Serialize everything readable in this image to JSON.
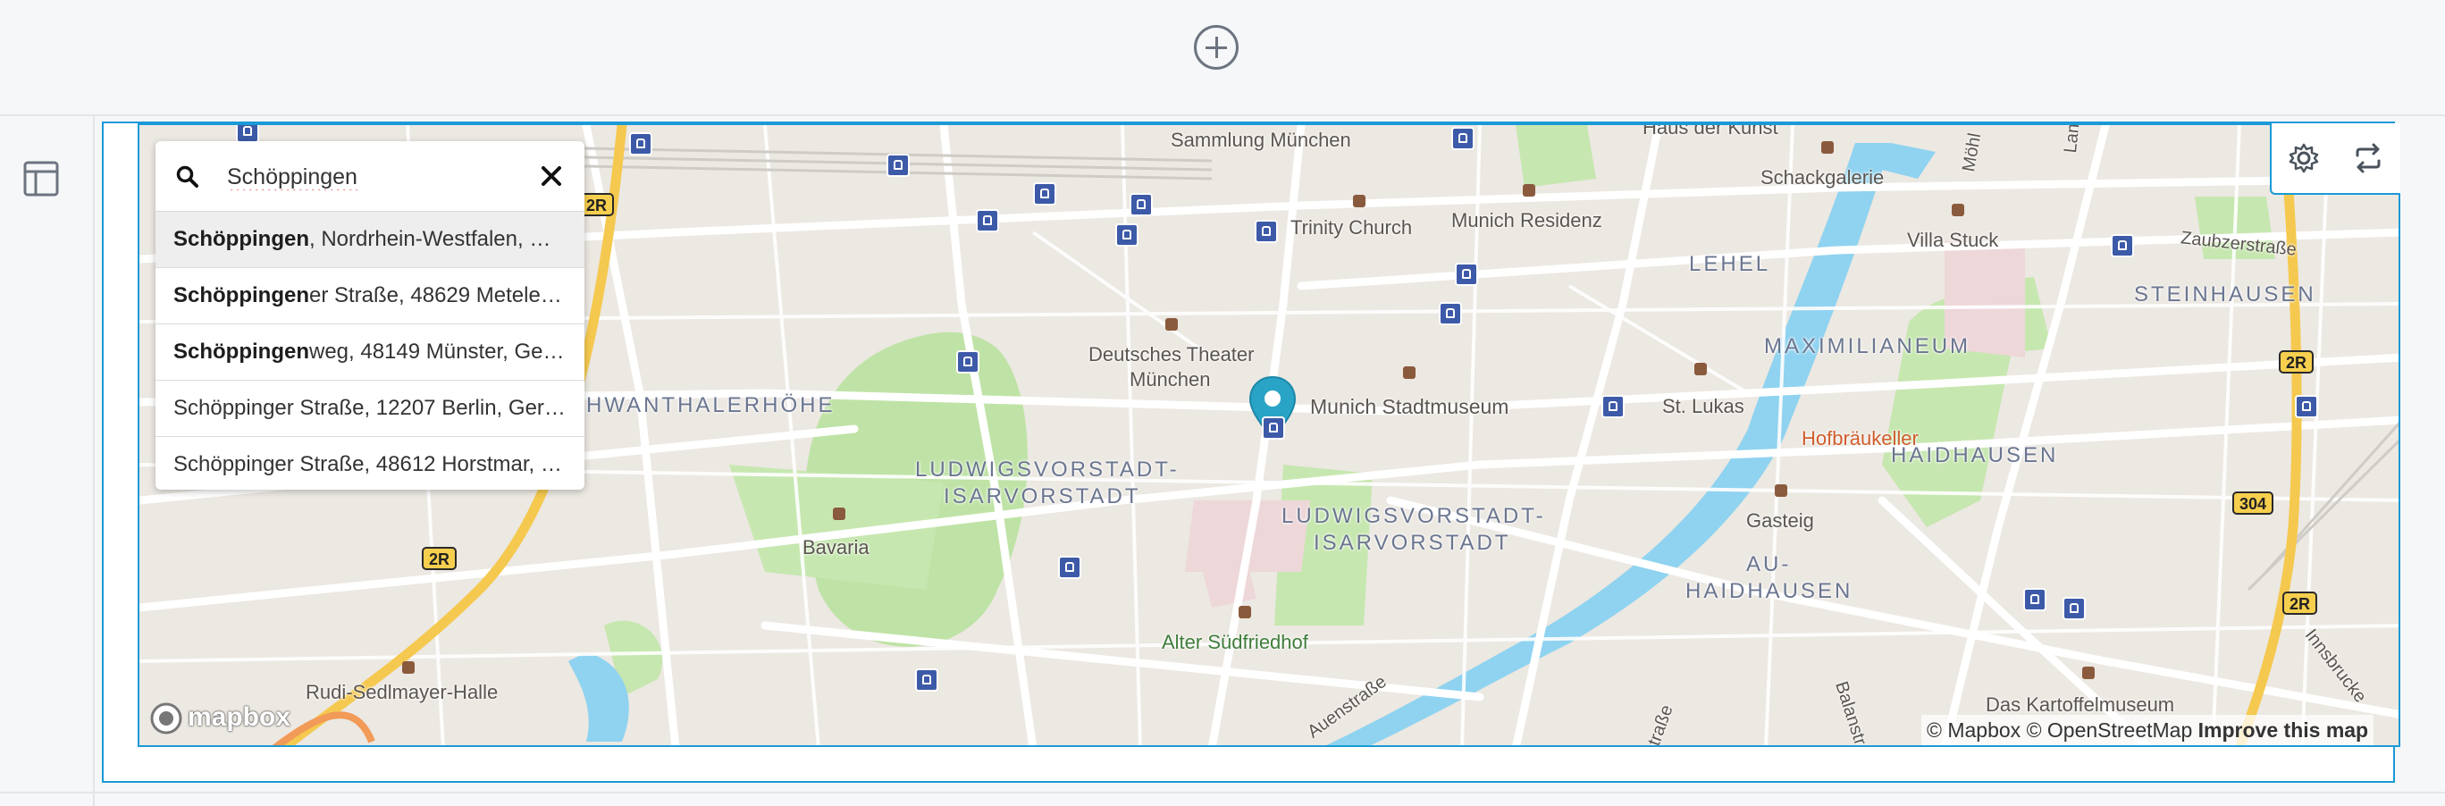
{
  "toolbar": {
    "add_icon": "plus-circle-icon"
  },
  "sidebar": {
    "layout_icon": "layout-icon"
  },
  "map_controls": {
    "settings_icon": "gear-icon",
    "swap_icon": "repeat-icon"
  },
  "search": {
    "value": "Schöppingen",
    "suggestions": [
      {
        "match": "Schöppingen",
        "rest": ", Nordrhein-Westfalen, G…"
      },
      {
        "match": "Schöppingen",
        "rest": "er Straße, 48629 Metele…"
      },
      {
        "match": "Schöppingen",
        "rest": "weg, 48149 Münster, Ge…"
      },
      {
        "match": "",
        "rest": "Schöppinger Straße, 12207 Berlin, Ger…"
      },
      {
        "match": "",
        "rest": "Schöppinger Straße, 48612 Horstmar, …"
      }
    ]
  },
  "map_labels": {
    "sammlung": "Sammlung München",
    "haus_kunst": "Haus der Kunst",
    "trinity": "Trinity Church",
    "residenz": "Munich Residenz",
    "schackgalerie": "Schackgalerie",
    "villa_stuck": "Villa Stuck",
    "zaubzer": "Zaubzerstraße",
    "lamont": "Lamontstr.",
    "moehl": "Möhl",
    "lehel": "LEHEL",
    "steinhausen": "STEINHAUSEN",
    "maximilianeum": "MAXIMILIANEUM",
    "theater": "Deutsches Theater",
    "theater2": "München",
    "schwanthaler": "HWANTHALERHÖHE",
    "stadtmuseum": "Munich Stadtmuseum",
    "st_lukas": "St. Lukas",
    "hofbraeu": "Hofbräukeller",
    "haidhausen": "HAIDHAUSEN",
    "ludwig1a": "LUDWIGSVORSTADT-",
    "ludwig1b": "ISARVORSTADT",
    "ludwig2a": "LUDWIGSVORSTADT-",
    "ludwig2b": "ISARVORSTADT",
    "bavaria": "Bavaria",
    "gasteig": "Gasteig",
    "au1": "AU-",
    "au2": "HAIDHAUSEN",
    "alter": "Alter Südfriedhof",
    "rudi": "Rudi-Sedlmayer-Halle",
    "auen": "Auenstraße",
    "balan": "Balanstr.",
    "kartoffel": "Das Kartoffelmuseum",
    "innsbr": "Innsbrucke",
    "strasse": "traße"
  },
  "shields": {
    "s2r_a": "2R",
    "s2r_b": "2R",
    "s2r_c": "2R",
    "s2r_d": "2R",
    "s304": "304"
  },
  "attribution": {
    "mapbox": "© Mapbox",
    "osm": "© OpenStreetMap",
    "improve": "Improve this map",
    "logo": "mapbox"
  },
  "colors": {
    "accent": "#1a9ad6",
    "marker": "#2aa4c6",
    "park": "#bfe3a6",
    "water": "#8fd3f0",
    "transit": "#3d5aa8",
    "highway": "#f5c94f"
  }
}
